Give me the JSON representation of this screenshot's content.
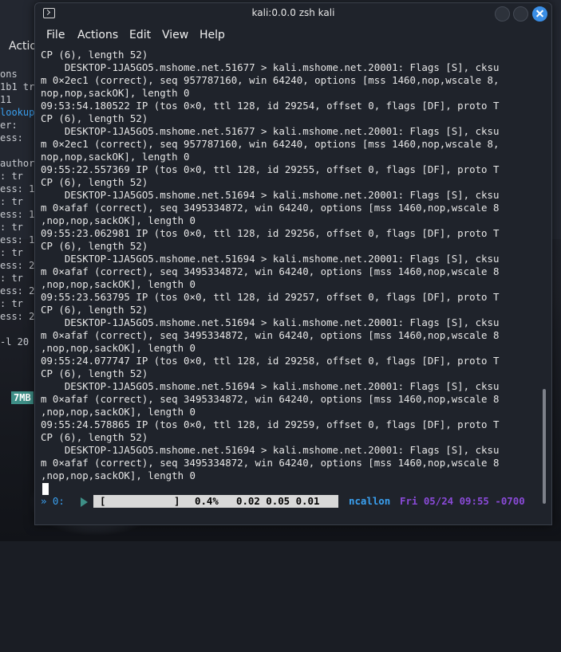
{
  "window": {
    "title": "kali:0.0.0 zsh kali"
  },
  "menu": [
    "File",
    "Actions",
    "Edit",
    "View",
    "Help"
  ],
  "background_window": {
    "actions_label": "Actio",
    "tag": "7MB",
    "fragments": [
      {
        "text": "ons",
        "accent": false
      },
      {
        "text": "1b1  tr",
        "accent": false
      },
      {
        "text": "  11",
        "accent": false
      },
      {
        "text": "lookup",
        "accent": true
      },
      {
        "text": "er:",
        "accent": false
      },
      {
        "text": "ess:",
        "accent": false
      },
      {
        "text": "",
        "accent": false
      },
      {
        "text": "author",
        "accent": false
      },
      {
        "text": ":  tr",
        "accent": false
      },
      {
        "text": "ess: 1",
        "accent": false
      },
      {
        "text": ":  tr",
        "accent": false
      },
      {
        "text": "ess: 1",
        "accent": false
      },
      {
        "text": ":  tr",
        "accent": false
      },
      {
        "text": "ess: 1",
        "accent": false
      },
      {
        "text": ":  tr",
        "accent": false
      },
      {
        "text": "ess: 2",
        "accent": false
      },
      {
        "text": ":  tr",
        "accent": false
      },
      {
        "text": "ess: 2",
        "accent": false
      },
      {
        "text": ":  tr",
        "accent": false
      },
      {
        "text": "ess: 2",
        "accent": false
      },
      {
        "text": "",
        "accent": false
      },
      {
        "text": " -l 20",
        "accent": false
      }
    ]
  },
  "terminal": {
    "lines": [
      "CP (6), length 52)",
      "    DESKTOP-1JA5GO5.mshome.net.51677 > kali.mshome.net.20001: Flags [S], cksu",
      "m 0×2ec1 (correct), seq 957787160, win 64240, options [mss 1460,nop,wscale 8,",
      "nop,nop,sackOK], length 0",
      "09:53:54.180522 IP (tos 0×0, ttl 128, id 29254, offset 0, flags [DF], proto T",
      "CP (6), length 52)",
      "    DESKTOP-1JA5GO5.mshome.net.51677 > kali.mshome.net.20001: Flags [S], cksu",
      "m 0×2ec1 (correct), seq 957787160, win 64240, options [mss 1460,nop,wscale 8,",
      "nop,nop,sackOK], length 0",
      "09:55:22.557369 IP (tos 0×0, ttl 128, id 29255, offset 0, flags [DF], proto T",
      "CP (6), length 52)",
      "    DESKTOP-1JA5GO5.mshome.net.51694 > kali.mshome.net.20001: Flags [S], cksu",
      "m 0×afaf (correct), seq 3495334872, win 64240, options [mss 1460,nop,wscale 8",
      ",nop,nop,sackOK], length 0",
      "09:55:23.062981 IP (tos 0×0, ttl 128, id 29256, offset 0, flags [DF], proto T",
      "CP (6), length 52)",
      "    DESKTOP-1JA5GO5.mshome.net.51694 > kali.mshome.net.20001: Flags [S], cksu",
      "m 0×afaf (correct), seq 3495334872, win 64240, options [mss 1460,nop,wscale 8",
      ",nop,nop,sackOK], length 0",
      "09:55:23.563795 IP (tos 0×0, ttl 128, id 29257, offset 0, flags [DF], proto T",
      "CP (6), length 52)",
      "    DESKTOP-1JA5GO5.mshome.net.51694 > kali.mshome.net.20001: Flags [S], cksu",
      "m 0×afaf (correct), seq 3495334872, win 64240, options [mss 1460,nop,wscale 8",
      ",nop,nop,sackOK], length 0",
      "09:55:24.077747 IP (tos 0×0, ttl 128, id 29258, offset 0, flags [DF], proto T",
      "CP (6), length 52)",
      "    DESKTOP-1JA5GO5.mshome.net.51694 > kali.mshome.net.20001: Flags [S], cksu",
      "m 0×afaf (correct), seq 3495334872, win 64240, options [mss 1460,nop,wscale 8",
      ",nop,nop,sackOK], length 0",
      "09:55:24.578865 IP (tos 0×0, ttl 128, id 29259, offset 0, flags [DF], proto T",
      "CP (6), length 52)",
      "    DESKTOP-1JA5GO5.mshome.net.51694 > kali.mshome.net.20001: Flags [S], cksu",
      "m 0×afaf (correct), seq 3495334872, win 64240, options [mss 1460,nop,wscale 8",
      ",nop,nop,sackOK], length 0"
    ]
  },
  "statusbar": {
    "window_index": "» 0:",
    "bar_open": "[",
    "bar_close": "]",
    "cpu_percent": "0.4%",
    "load_avg": "0.02 0.05 0.01",
    "user": "ncallon",
    "datetime": "Fri 05/24 09:55 -0700"
  },
  "colors": {
    "accent_blue": "#3aa0f0",
    "teal": "#3e8f87",
    "purple": "#8a4ad8",
    "terminal_bg": "#1f232b"
  }
}
